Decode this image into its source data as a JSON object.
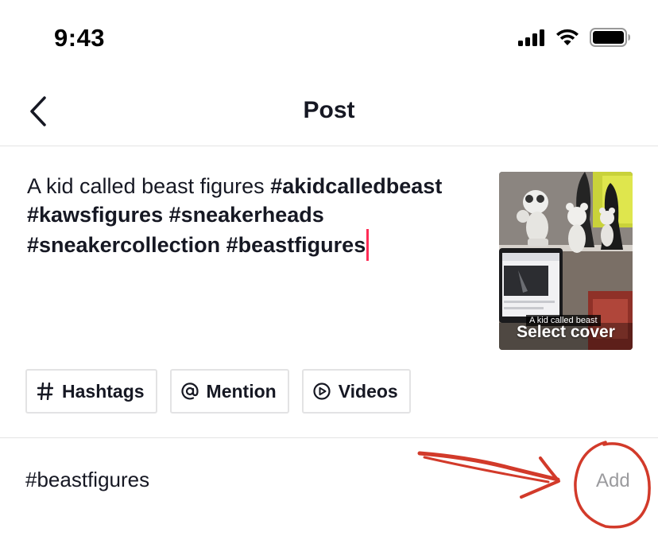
{
  "status_bar": {
    "time": "9:43",
    "icons": [
      "signal-icon",
      "wifi-icon",
      "battery-icon"
    ]
  },
  "nav": {
    "title": "Post",
    "back_icon": "chevron-left-icon"
  },
  "caption": {
    "plain_text": "A kid called beast figures ",
    "hashtags": [
      "#akidcalledbeast",
      "#kawsfigures",
      "#sneakerheads",
      "#sneakercollection",
      "#beastfigures"
    ],
    "cursor_color": "#fe2c55"
  },
  "cover": {
    "label": "A kid called beast",
    "select_text": "Select cover"
  },
  "chips": [
    {
      "icon": "hashtag-icon",
      "label": "Hashtags"
    },
    {
      "icon": "at-icon",
      "label": "Mention"
    },
    {
      "icon": "play-circle-icon",
      "label": "Videos"
    }
  ],
  "suggestion": {
    "text": "#beastfigures",
    "add_label": "Add"
  },
  "annotation": {
    "color": "#d23a2a",
    "shapes": [
      "arrow",
      "circle"
    ]
  }
}
